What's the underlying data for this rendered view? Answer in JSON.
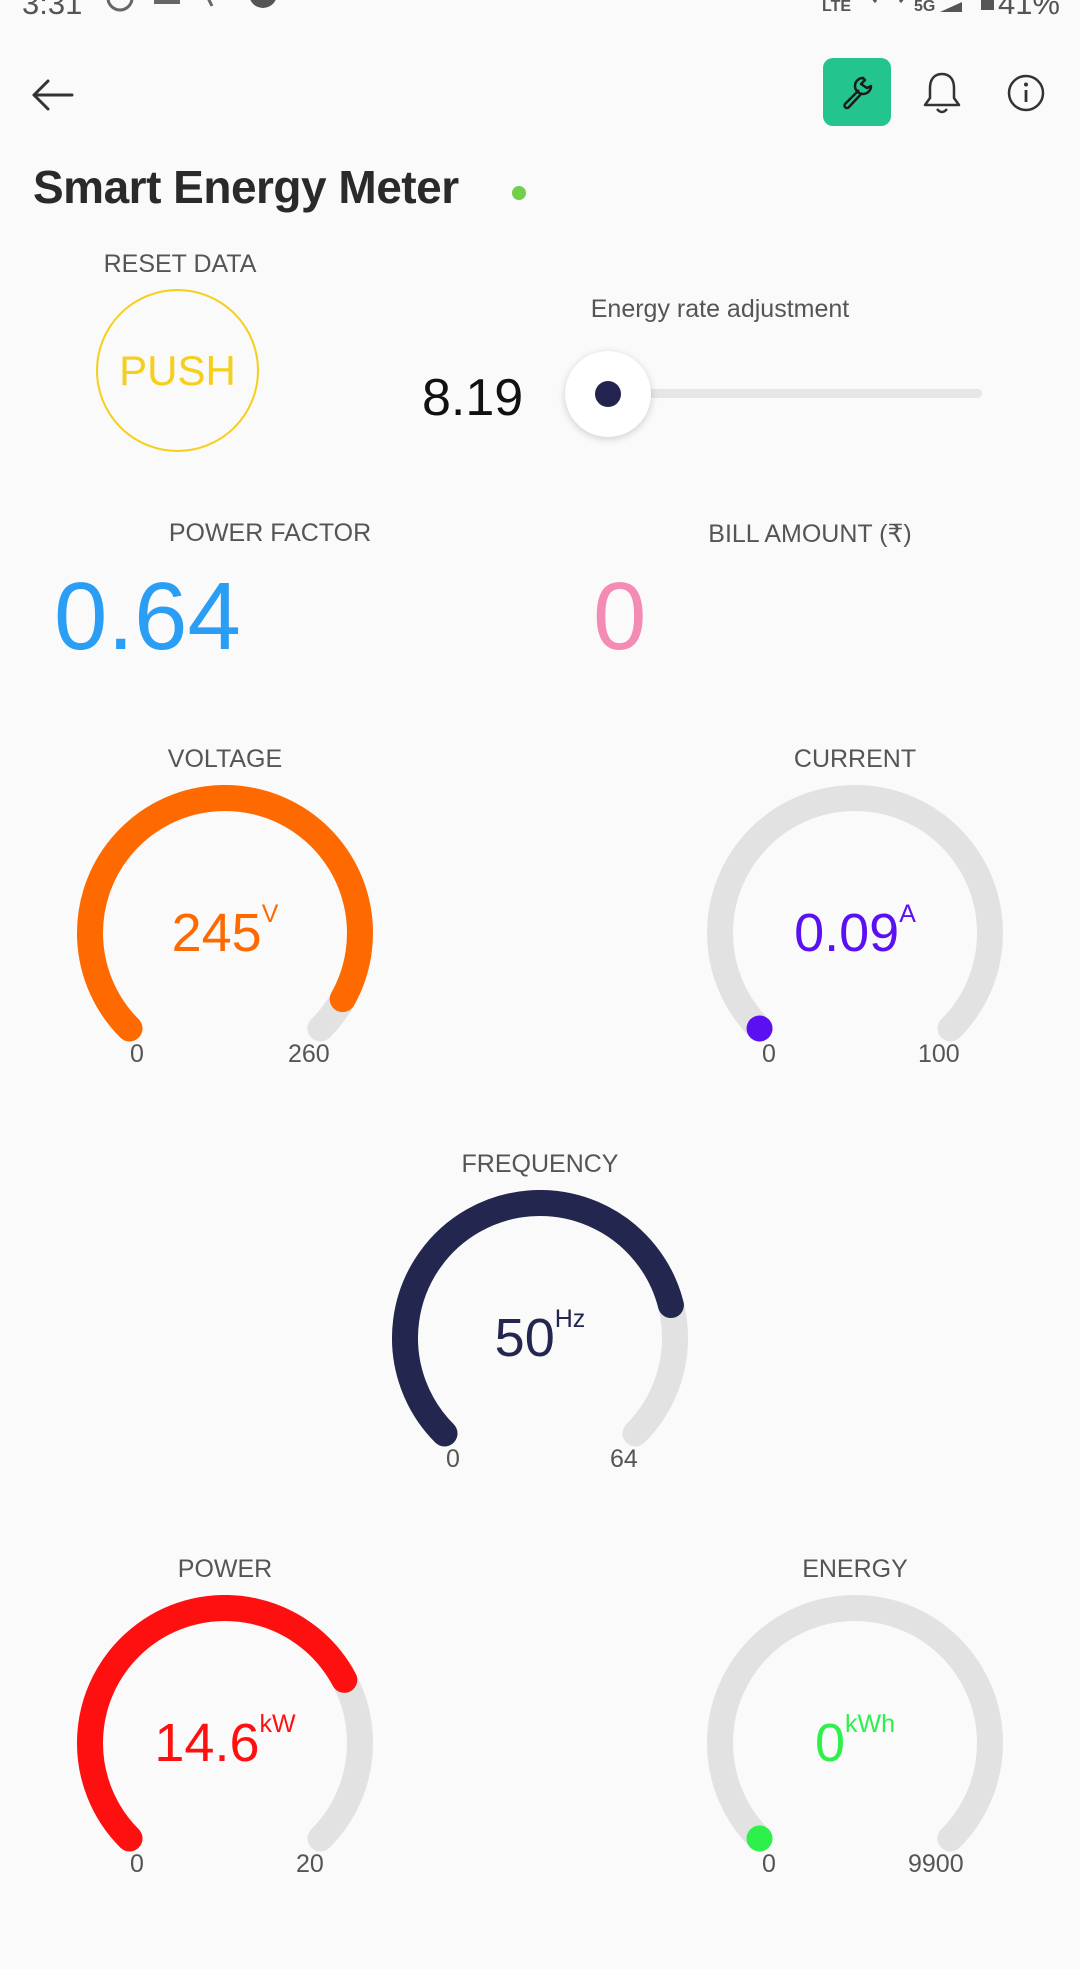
{
  "status_bar": {
    "time": "3:31",
    "battery": "41%",
    "net_lte": "LTE",
    "net_5g": "5G"
  },
  "header": {
    "title": "Smart Energy Meter"
  },
  "reset": {
    "label": "RESET DATA",
    "button": "PUSH"
  },
  "rate": {
    "label": "Energy rate adjustment",
    "value": "8.19",
    "fraction": 0.0
  },
  "power_factor": {
    "label": "POWER FACTOR",
    "value": "0.64"
  },
  "bill": {
    "label": "BILL AMOUNT (₹)",
    "value": "0"
  },
  "gauges": {
    "voltage": {
      "label": "VOLTAGE",
      "value": "245",
      "unit": "V",
      "min": "0",
      "max": "260",
      "fraction": 0.942,
      "color": "#ff6a00"
    },
    "current": {
      "label": "CURRENT",
      "value": "0.09",
      "unit": "A",
      "min": "0",
      "max": "100",
      "fraction": 0.0009,
      "color": "#5a10f0"
    },
    "frequency": {
      "label": "FREQUENCY",
      "value": "50",
      "unit": "Hz",
      "min": "0",
      "max": "64",
      "fraction": 0.781,
      "color": "#23264f"
    },
    "power": {
      "label": "POWER",
      "value": "14.6",
      "unit": "kW",
      "min": "0",
      "max": "20",
      "fraction": 0.73,
      "color": "#ff1010"
    },
    "energy": {
      "label": "ENERGY",
      "value": "0",
      "unit": "kWh",
      "min": "0",
      "max": "9900",
      "fraction": 0.0,
      "color": "#2ef04a"
    }
  },
  "colors": {
    "accent": "#23c48e",
    "push": "#f5cf1a",
    "power_factor": "#2a9df4",
    "bill": "#f48bb5",
    "online": "#6fd04a"
  }
}
